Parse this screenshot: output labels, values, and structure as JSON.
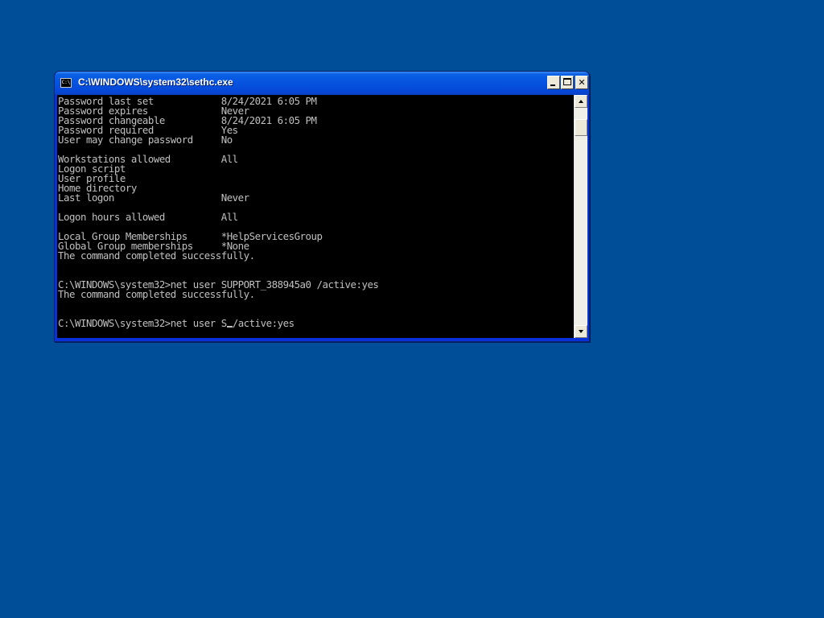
{
  "window": {
    "title": "C:\\WINDOWS\\system32\\sethc.exe",
    "icon_label": "C:\\",
    "minimize_icon": "minimize-icon",
    "maximize_icon": "maximize-icon",
    "close_icon": "close-icon",
    "close_label": "✕"
  },
  "colors": {
    "desktop": "#004e98",
    "titlebar": "#0553e0",
    "console_bg": "#000000",
    "console_text": "#c0c0c0"
  },
  "console": {
    "lines": [
      "Password last set            8/24/2021 6:05 PM",
      "Password expires             Never",
      "Password changeable          8/24/2021 6:05 PM",
      "Password required            Yes",
      "User may change password     No",
      "",
      "Workstations allowed         All",
      "Logon script",
      "User profile",
      "Home directory",
      "Last logon                   Never",
      "",
      "Logon hours allowed          All",
      "",
      "Local Group Memberships      *HelpServicesGroup",
      "Global Group memberships     *None",
      "The command completed successfully.",
      "",
      "",
      "C:\\WINDOWS\\system32>net user SUPPORT_388945a0 /active:yes",
      "The command completed successfully.",
      "",
      "",
      "C:\\WINDOWS\\system32>net user S"
    ],
    "last_line_after_cursor": "/active:yes"
  },
  "scrollbar": {
    "up_icon": "scroll-up-arrow-icon",
    "down_icon": "scroll-down-arrow-icon"
  }
}
